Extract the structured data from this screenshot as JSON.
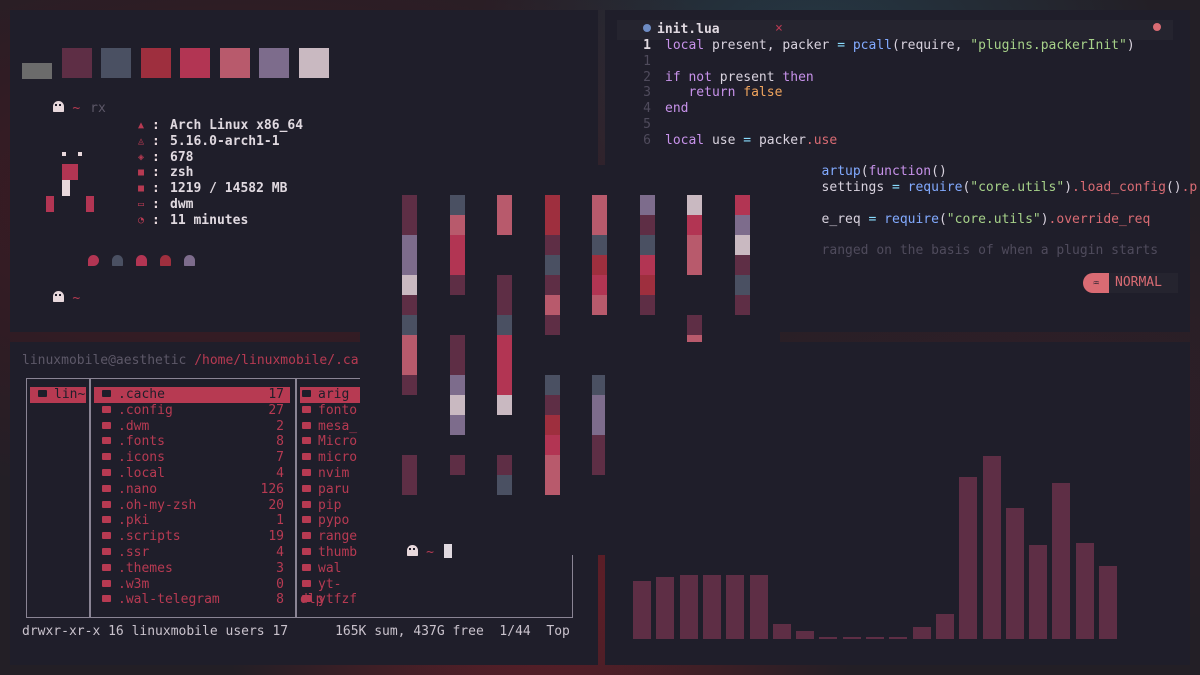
{
  "fetch": {
    "palette": [
      "#6b6b6b",
      "#5e2e45",
      "#4a5062",
      "#9e2f3e",
      "#b23553",
      "#b85a6c",
      "#7d6c8c",
      "#c9b9c1"
    ],
    "prompt1_cmd": "rx",
    "tilde": "~",
    "info": [
      {
        "icon": "arch-icon",
        "glyph": "▲",
        "value": "Arch Linux x86_64"
      },
      {
        "icon": "kernel-icon",
        "glyph": "◬",
        "value": "5.16.0-arch1-1"
      },
      {
        "icon": "package-icon",
        "glyph": "◈",
        "value": "678"
      },
      {
        "icon": "shell-icon",
        "glyph": "■",
        "value": "zsh"
      },
      {
        "icon": "memory-icon",
        "glyph": "■",
        "value": "1219 / 14582 MB"
      },
      {
        "icon": "wm-icon",
        "glyph": "▭",
        "value": "dwm"
      },
      {
        "icon": "uptime-icon",
        "glyph": "◔",
        "value": "11 minutes"
      }
    ],
    "colon": ":"
  },
  "editor": {
    "tab_name": "init.lua",
    "tab_close": "×",
    "mode": "NORMAL",
    "mode_badge": "♒",
    "lines": [
      {
        "n": "1",
        "html": "<span class=\"kw\">local</span> <span class=\"tx\">present, packer</span> <span class=\"op\">=</span> <span class=\"fn\">pcall</span><span class=\"tx\">(require, </span><span class=\"str\">\"plugins.packerInit\"</span><span class=\"tx\">)</span>"
      },
      {
        "n": "1",
        "html": ""
      },
      {
        "n": "2",
        "html": "<span class=\"kw\">if not</span> <span class=\"tx\">present</span> <span class=\"kw\">then</span>"
      },
      {
        "n": "3",
        "html": "   <span class=\"kw\">return</span> <span class=\"bool\">false</span>"
      },
      {
        "n": "4",
        "html": "<span class=\"kw\">end</span>"
      },
      {
        "n": "5",
        "html": ""
      },
      {
        "n": "6",
        "html": "<span class=\"kw\">local</span> <span class=\"tx\">use</span> <span class=\"op\">=</span> <span class=\"tx\">packer</span><span class=\"pr\">.use</span>"
      },
      {
        "n": "",
        "html": ""
      },
      {
        "n": "",
        "html": "                    <span class=\"fn\">artup</span><span class=\"tx\">(</span><span class=\"kw\">function</span><span class=\"tx\">()</span>"
      },
      {
        "n": "",
        "html": "                    <span class=\"tx\">settings</span> <span class=\"op\">=</span> <span class=\"fn\">require</span><span class=\"tx\">(</span><span class=\"str\">\"core.utils\"</span><span class=\"tx\">)</span><span class=\"pr\">.load_config</span><span class=\"tx\">()</span><span class=\"pr\">.p</span>"
      },
      {
        "n": "",
        "html": ""
      },
      {
        "n": "",
        "html": "                    <span class=\"tx\">e_req</span> <span class=\"op\">=</span> <span class=\"fn\">require</span><span class=\"tx\">(</span><span class=\"str\">\"core.utils\"</span><span class=\"tx\">)</span><span class=\"pr\">.override_req</span>"
      },
      {
        "n": "",
        "html": ""
      },
      {
        "n": "",
        "html": "                    <span class=\"cm\">ranged on the basis of when a plugin starts</span>"
      }
    ]
  },
  "fm": {
    "user": "linuxmobile@aesthetic",
    "path": "/home/linuxmobile/.ca",
    "left_item": "lin~",
    "items": [
      {
        "name": ".cache",
        "count": "17",
        "sel": true
      },
      {
        "name": ".config",
        "count": "27"
      },
      {
        "name": ".dwm",
        "count": "2"
      },
      {
        "name": ".fonts",
        "count": "8"
      },
      {
        "name": ".icons",
        "count": "7"
      },
      {
        "name": ".local",
        "count": "4"
      },
      {
        "name": ".nano",
        "count": "126"
      },
      {
        "name": ".oh-my-zsh",
        "count": "20"
      },
      {
        "name": ".pki",
        "count": "1"
      },
      {
        "name": ".scripts",
        "count": "19"
      },
      {
        "name": ".ssr",
        "count": "4"
      },
      {
        "name": ".themes",
        "count": "3"
      },
      {
        "name": ".w3m",
        "count": "0"
      },
      {
        "name": ".wal-telegram",
        "count": "8"
      }
    ],
    "right_items": [
      "arig",
      "fonto",
      "mesa_",
      "Micro",
      "micro",
      "nvim",
      "paru",
      "pip",
      "pypo",
      "range",
      "thumb",
      "wal",
      "yt-dlp",
      "ytfzf"
    ],
    "status": "drwxr-xr-x 16 linuxmobile users 17      165K sum, 437G free  1/44  Top"
  },
  "terminal": {
    "tilde": "~"
  },
  "visualizer": {
    "columns": [
      [
        "#5e2e45",
        "#5e2e45",
        "#7d6c8c",
        "#7d6c8c",
        "#c9b9c1",
        "#5e2e45",
        "#4a5062",
        "#b85a6c",
        "#b85a6c",
        "#5e2e45",
        "",
        "",
        "",
        "#5e2e45",
        "#5e2e45"
      ],
      [
        "#4a5062",
        "#b85a6c",
        "#b23553",
        "#b23553",
        "#5e2e45",
        "",
        "",
        "#5e2e45",
        "#5e2e45",
        "#7d6c8c",
        "#c9b9c1",
        "#7d6c8c",
        "",
        "#5e2e45",
        ""
      ],
      [
        "#b85a6c",
        "#b85a6c",
        "",
        "",
        "#5e2e45",
        "#5e2e45",
        "#4a5062",
        "#b23553",
        "#b23553",
        "#b23553",
        "#c9b9c1",
        "",
        "",
        "#5e2e45",
        "#4a5062"
      ],
      [
        "#9e2f3e",
        "#9e2f3e",
        "#5e2e45",
        "#4a5062",
        "#5e2e45",
        "#b85a6c",
        "#5e2e45",
        "",
        "",
        "#4a5062",
        "#5e2e45",
        "#9e2f3e",
        "#b23553",
        "#b85a6c",
        "#b85a6c"
      ],
      [
        "#b85a6c",
        "#b85a6c",
        "#4a5062",
        "#9e2f3e",
        "#b23553",
        "#b85a6c",
        "",
        "",
        "",
        "#4a5062",
        "#7d6c8c",
        "#7d6c8c",
        "#5e2e45",
        "#5e2e45",
        ""
      ],
      [
        "#7d6c8c",
        "#5e2e45",
        "#4a5062",
        "#b23553",
        "#9e2f3e",
        "#5e2e45",
        "",
        "",
        "",
        "#9e2f3e",
        "#b85a6c",
        "#5e2e45",
        "#7d6c8c",
        "#7d6c8c",
        ""
      ],
      [
        "#c9b9c1",
        "#b23553",
        "#b85a6c",
        "#b85a6c",
        "",
        "",
        "#5e2e45",
        "#b85a6c",
        "#b85a6c",
        "#b85a6c",
        "#c9b9c1",
        "",
        "#b23553",
        "#5e2e45",
        "#5e2e45"
      ],
      [
        "#b23553",
        "#7d6c8c",
        "#c9b9c1",
        "#5e2e45",
        "#4a5062",
        "#5e2e45",
        "",
        "",
        "",
        "#9e2f3e",
        "#5e2e45",
        "#5e2e45",
        "",
        "#4a5062",
        "#4a5062"
      ]
    ]
  },
  "cava": {
    "levels": [
      0.28,
      0.3,
      0.31,
      0.31,
      0.31,
      0.31,
      0.07,
      0.04,
      0.01,
      0.01,
      0.01,
      0.01,
      0.06,
      0.12,
      0.78,
      0.88,
      0.63,
      0.45,
      0.75,
      0.46,
      0.35
    ]
  }
}
